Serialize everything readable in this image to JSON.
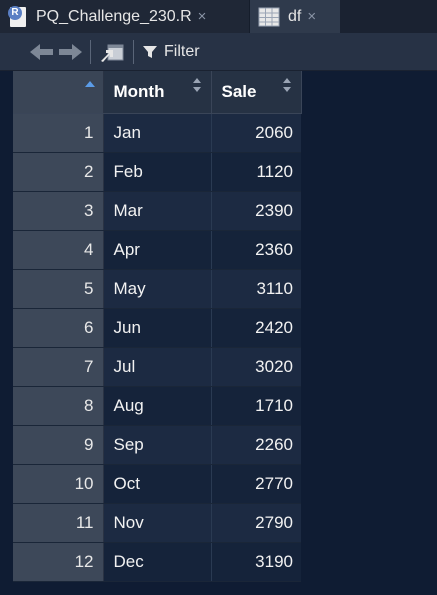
{
  "tabs": [
    {
      "label": "PQ_Challenge_230.R",
      "icon": "r-file-icon",
      "close": "×"
    },
    {
      "label": "df",
      "icon": "data-grid-icon",
      "close": "×"
    }
  ],
  "toolbar": {
    "filter_label": "Filter"
  },
  "table": {
    "columns": [
      "Month",
      "Sale"
    ],
    "rows": [
      {
        "index": "1",
        "month": "Jan",
        "sale": "2060"
      },
      {
        "index": "2",
        "month": "Feb",
        "sale": "1120"
      },
      {
        "index": "3",
        "month": "Mar",
        "sale": "2390"
      },
      {
        "index": "4",
        "month": "Apr",
        "sale": "2360"
      },
      {
        "index": "5",
        "month": "May",
        "sale": "3110"
      },
      {
        "index": "6",
        "month": "Jun",
        "sale": "2420"
      },
      {
        "index": "7",
        "month": "Jul",
        "sale": "3020"
      },
      {
        "index": "8",
        "month": "Aug",
        "sale": "1710"
      },
      {
        "index": "9",
        "month": "Sep",
        "sale": "2260"
      },
      {
        "index": "10",
        "month": "Oct",
        "sale": "2770"
      },
      {
        "index": "11",
        "month": "Nov",
        "sale": "2790"
      },
      {
        "index": "12",
        "month": "Dec",
        "sale": "3190"
      }
    ]
  },
  "colors": {
    "background": "#0f1c33",
    "sort_accent": "#5b9ce8"
  }
}
